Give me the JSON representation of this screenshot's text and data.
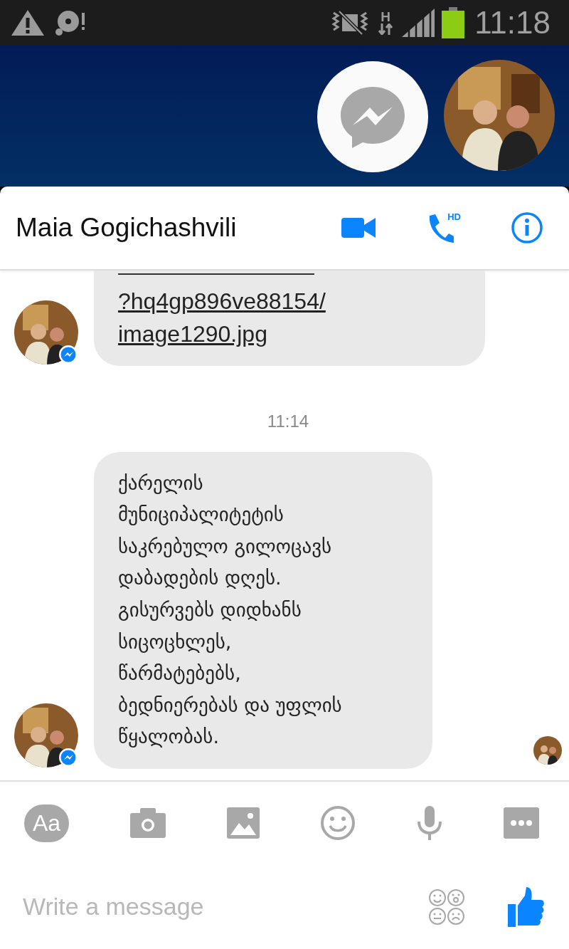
{
  "status_bar": {
    "network": "H",
    "time": "11:18"
  },
  "header": {
    "name": "Maia Gogichashvili",
    "call_badge": "HD"
  },
  "messages": [
    {
      "kind": "link",
      "text": "?hq4gp896ve88154/\nimage1290.jpg",
      "cut_top": true
    },
    {
      "kind": "time",
      "text": "11:14"
    },
    {
      "kind": "text",
      "text": "ქარელის\nმუნიციპალიტეტის\nსაკრებულო გილოცავს\nდაბადების დღეს.\nგისურვებს დიდხანს\nსიცოცხლეს,\nწარმატებებს,\nბედნიერებას და უფლის\nწყალობას.",
      "seen": true
    }
  ],
  "toolbar": {
    "text_button": "Aa"
  },
  "composer": {
    "placeholder": "Write a message"
  }
}
